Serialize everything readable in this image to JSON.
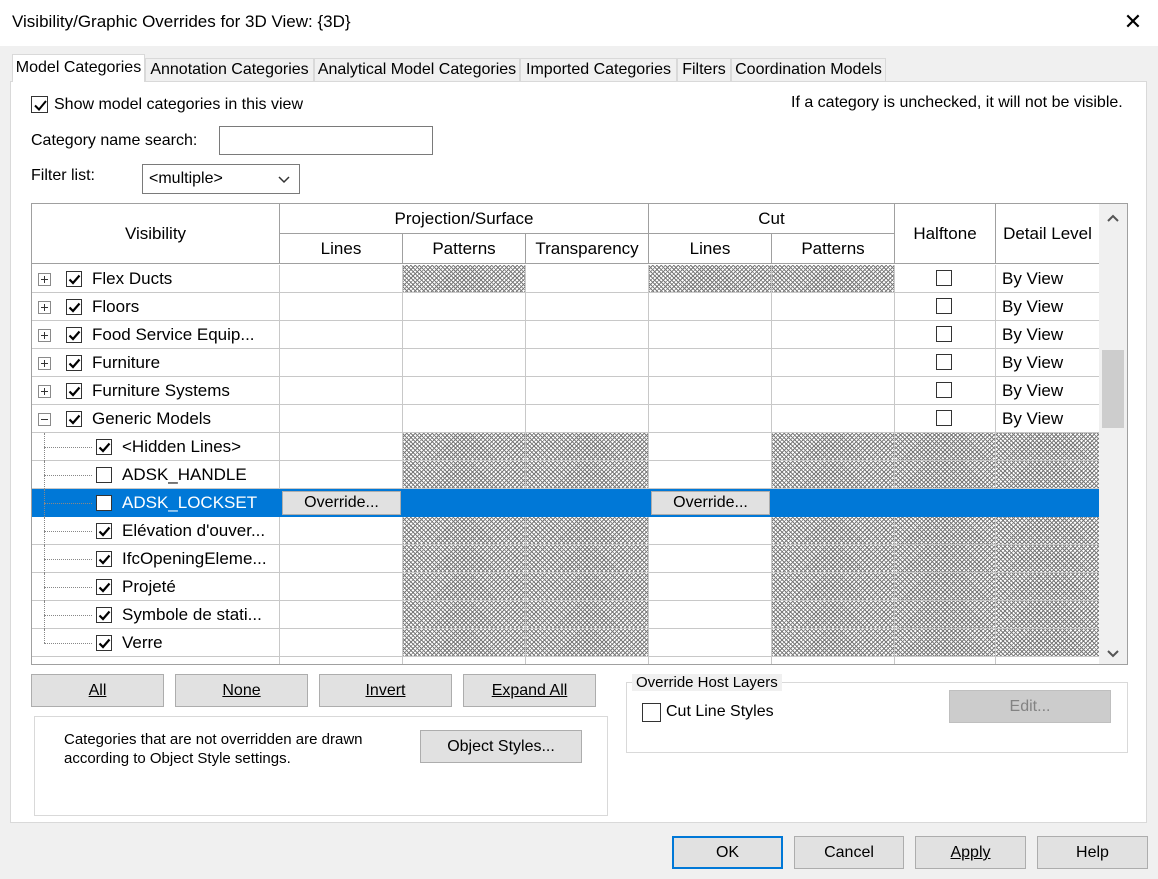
{
  "window": {
    "title": "Visibility/Graphic Overrides for 3D View: {3D}",
    "close_glyph": "✕"
  },
  "tabs": [
    {
      "label": "Model Categories",
      "active": true
    },
    {
      "label": "Annotation Categories",
      "active": false
    },
    {
      "label": "Analytical Model Categories",
      "active": false
    },
    {
      "label": "Imported Categories",
      "active": false
    },
    {
      "label": "Filters",
      "active": false
    },
    {
      "label": "Coordination Models",
      "active": false
    }
  ],
  "options": {
    "show_categories_label": "Show model categories in this view",
    "show_categories_checked": true,
    "note": "If a category is unchecked, it will not be visible.",
    "search_label": "Category name search:",
    "search_value": "",
    "filter_label": "Filter list:",
    "filter_value": "<multiple>"
  },
  "grid": {
    "headers": {
      "visibility": "Visibility",
      "projection_surface": "Projection/Surface",
      "cut": "Cut",
      "halftone": "Halftone",
      "detail_level": "Detail Level",
      "lines": "Lines",
      "patterns": "Patterns",
      "transparency": "Transparency",
      "cut_lines": "Lines",
      "cut_patterns": "Patterns"
    },
    "override_label": "Override...",
    "rows": [
      {
        "name": "Flex Ducts",
        "level": 0,
        "expander": "plus",
        "checked": true,
        "hatch": [
          "patterns",
          "cut_lines",
          "cut_patterns"
        ],
        "halftone": false,
        "detail": "By View"
      },
      {
        "name": "Floors",
        "level": 0,
        "expander": "plus",
        "checked": true,
        "hatch": [],
        "halftone": false,
        "detail": "By View"
      },
      {
        "name": "Food Service Equip...",
        "level": 0,
        "expander": "plus",
        "checked": true,
        "hatch": [],
        "halftone": false,
        "detail": "By View"
      },
      {
        "name": "Furniture",
        "level": 0,
        "expander": "plus",
        "checked": true,
        "hatch": [],
        "halftone": false,
        "detail": "By View"
      },
      {
        "name": "Furniture Systems",
        "level": 0,
        "expander": "plus",
        "checked": true,
        "hatch": [],
        "halftone": false,
        "detail": "By View"
      },
      {
        "name": "Generic Models",
        "level": 0,
        "expander": "minus",
        "checked": true,
        "hatch": [],
        "halftone": false,
        "detail": "By View"
      },
      {
        "name": "<Hidden Lines>",
        "level": 1,
        "checked": true,
        "hatch": [
          "patterns",
          "transparency",
          "cut_patterns",
          "halftone",
          "detail"
        ],
        "detail": ""
      },
      {
        "name": "ADSK_HANDLE",
        "level": 1,
        "checked": false,
        "hatch": [
          "patterns",
          "transparency",
          "cut_patterns",
          "halftone",
          "detail"
        ],
        "detail": ""
      },
      {
        "name": "ADSK_LOCKSET",
        "level": 1,
        "checked": false,
        "selected": true,
        "hatch": [],
        "detail": ""
      },
      {
        "name": "Elévation d'ouver...",
        "level": 1,
        "checked": true,
        "hatch": [
          "patterns",
          "transparency",
          "cut_patterns",
          "halftone",
          "detail"
        ],
        "detail": ""
      },
      {
        "name": "IfcOpeningEleme...",
        "level": 1,
        "checked": true,
        "hatch": [
          "patterns",
          "transparency",
          "cut_patterns",
          "halftone",
          "detail"
        ],
        "detail": ""
      },
      {
        "name": "Projeté",
        "level": 1,
        "checked": true,
        "hatch": [
          "patterns",
          "transparency",
          "cut_patterns",
          "halftone",
          "detail"
        ],
        "detail": ""
      },
      {
        "name": "Symbole de stati...",
        "level": 1,
        "checked": true,
        "hatch": [
          "patterns",
          "transparency",
          "cut_patterns",
          "halftone",
          "detail"
        ],
        "detail": ""
      },
      {
        "name": "Verre",
        "level": 1,
        "checked": true,
        "hatch": [
          "patterns",
          "transparency",
          "cut_patterns",
          "halftone",
          "detail"
        ],
        "detail": ""
      }
    ]
  },
  "buttons": {
    "all": "All",
    "none": "None",
    "invert": "Invert",
    "expand_all": "Expand All",
    "object_styles": "Object Styles...",
    "edit": "Edit...",
    "ok": "OK",
    "cancel": "Cancel",
    "apply": "Apply",
    "help": "Help"
  },
  "info": {
    "line1": "Categories that are not overridden are drawn",
    "line2": "according to Object Style settings."
  },
  "host_layers": {
    "title": "Override Host Layers",
    "cut_line_styles_label": "Cut Line Styles",
    "cut_line_styles_checked": false
  }
}
